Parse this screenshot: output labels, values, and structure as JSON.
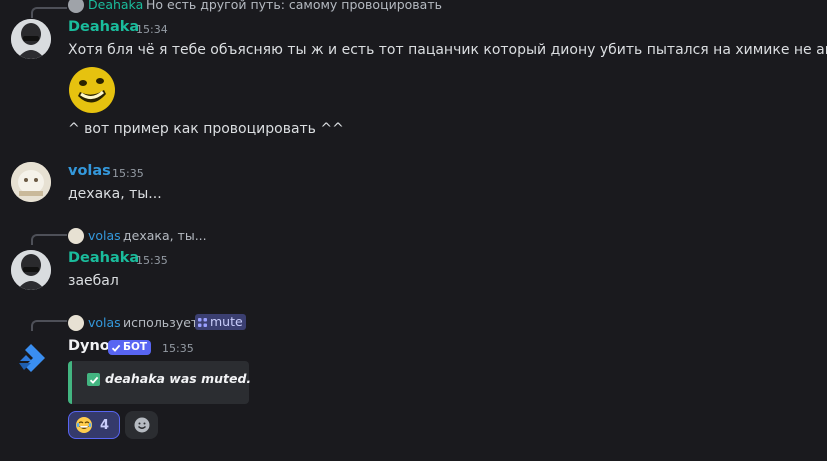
{
  "messages": {
    "m1": {
      "reply_name": "Deahaka",
      "reply_text": "Но есть другой путь: самому провоцировать",
      "username": "Deahaka",
      "timestamp": "15:34",
      "text": "Хотя бля чё я тебе объясняю ты ж и есть тот пацанчик который диону убить пытался на химике не антаге",
      "text2": "^ вот пример как провоцировать ^^",
      "emoji": "grinning-yellow-emoji"
    },
    "m2": {
      "username": "volas",
      "timestamp": "15:35",
      "text": "дехака, ты..."
    },
    "m3": {
      "reply_name": "volas",
      "reply_text": "дехака, ты...",
      "username": "Deahaka",
      "timestamp": "15:35",
      "text": "заебал"
    },
    "m4": {
      "reply_name": "volas",
      "reply_mid": "использует",
      "command": "mute",
      "username": "Dyno",
      "badge": "БОТ",
      "timestamp": "15:35",
      "embed_text": "deahaka was muted.",
      "reaction_count": "4"
    }
  },
  "colors": {
    "background": "#1a1a1e",
    "deahaka_name": "#1abc9c",
    "volas_name": "#3498db",
    "bot_badge": "#5865f2",
    "embed_border": "#43b581",
    "reaction_active_border": "#5865f2"
  },
  "icons": [
    "check-icon",
    "slash-command-icon",
    "add-reaction-icon",
    "dyno-logo-icon"
  ]
}
